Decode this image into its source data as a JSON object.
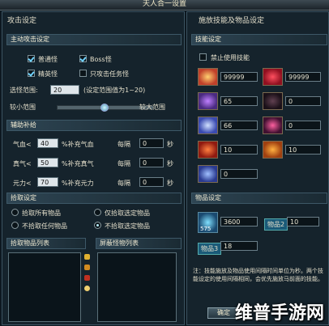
{
  "window": {
    "title": "天人合一设置"
  },
  "left": {
    "header": "攻击设定",
    "auto_attack": {
      "title": "主动攻击设定",
      "options": [
        {
          "label": "普通怪",
          "checked": true
        },
        {
          "label": "Boss怪",
          "checked": true
        },
        {
          "label": "精英怪",
          "checked": true
        },
        {
          "label": "只攻击任务怪",
          "checked": false
        }
      ],
      "range_label": "选怪范围:",
      "range_value": "20",
      "range_hint": "(设定范围值为1~20)",
      "small_label": "较小范围",
      "large_label": "较大范围",
      "slider_level": 0.62
    },
    "supplement": {
      "title": "辅助补给",
      "rows": [
        {
          "name": "气血<",
          "value": "40",
          "desc": "%补充气血",
          "every": "每隔",
          "interval": "0",
          "unit": "秒"
        },
        {
          "name": "真气<",
          "value": "50",
          "desc": "%补充真气",
          "every": "每隔",
          "interval": "0",
          "unit": "秒"
        },
        {
          "name": "元力<",
          "value": "70",
          "desc": "%补充元力",
          "every": "每隔",
          "interval": "0",
          "unit": "秒"
        }
      ]
    },
    "pickup": {
      "title": "拾取设定",
      "options": [
        {
          "label": "拾取所有物品",
          "selected": false
        },
        {
          "label": "仅拾取选定物品",
          "selected": false
        },
        {
          "label": "不拾取任何物品",
          "selected": false
        },
        {
          "label": "不拾取选定物品",
          "selected": true
        }
      ]
    },
    "lists": {
      "pickup_list": "拾取物品列表",
      "shield_list": "屏蔽怪物列表"
    }
  },
  "right": {
    "header": "施放技能及物品设定",
    "skills": {
      "title": "技能设定",
      "disable_label": "禁止使用技能",
      "disable_checked": false,
      "slots": [
        {
          "value": "99999",
          "color": "#c0402a"
        },
        {
          "value": "99999",
          "color": "#b01828"
        },
        {
          "value": "65",
          "color": "#6a3aa0"
        },
        {
          "value": "0",
          "color": "#3a2a30"
        },
        {
          "value": "66",
          "color": "#4a6ad0"
        },
        {
          "value": "0",
          "color": "#5a1a40"
        },
        {
          "value": "10",
          "color": "#c03020"
        },
        {
          "value": "10",
          "color": "#c05020"
        },
        {
          "value": "0",
          "color": "#4a5ab0"
        }
      ]
    },
    "items": {
      "title": "物品设定",
      "slots": [
        {
          "label": "575",
          "value": "3600"
        },
        {
          "label": "物品2",
          "value": "10"
        },
        {
          "label": "物品3",
          "value": "18"
        }
      ]
    },
    "note": "注：技能施放及物品使用间隔时间单位为秒。两个技能设定的使用间隔相同，会优先施放马前面的技能。",
    "confirm_button": "确定"
  },
  "watermark": "维普手游网"
}
